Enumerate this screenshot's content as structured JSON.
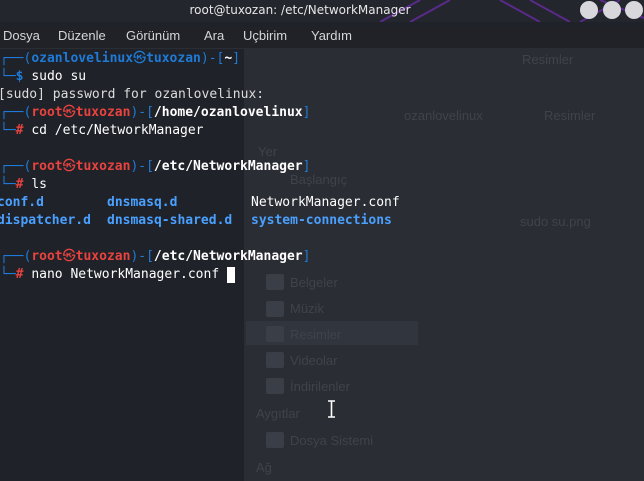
{
  "window": {
    "title": "root@tuxozan: /etc/NetworkManager"
  },
  "menu": {
    "items": [
      "Dosya",
      "Düzenle",
      "Görünüm",
      "Ara",
      "Uçbirim",
      "Yardım"
    ]
  },
  "terminal": {
    "lines": [
      {
        "user": "ozanlovelinux",
        "host": "tuxozan",
        "path": "~"
      },
      {
        "prompt": "$",
        "command": "sudo su"
      },
      {
        "output": "[sudo] password for ozanlovelinux:"
      },
      {
        "user": "root",
        "host": "tuxozan",
        "path": "/home/ozanlovelinux"
      },
      {
        "prompt": "#",
        "command": "cd /etc/NetworkManager"
      },
      {
        "user": "root",
        "host": "tuxozan",
        "path": "/etc/NetworkManager"
      },
      {
        "prompt": "#",
        "command": "ls"
      },
      {
        "user": "root",
        "host": "tuxozan",
        "path": "/etc/NetworkManager"
      },
      {
        "prompt": "#",
        "command": "nano NetworkManager.conf"
      }
    ],
    "ls_output": {
      "row1": [
        "conf.d",
        "dnsmasq.d",
        "NetworkManager.conf"
      ],
      "row2": [
        "dispatcher.d",
        "dnsmasq-shared.d",
        "system-connections"
      ]
    },
    "colors": {
      "frame": "#1f7bd8",
      "root_user": "#e8433f",
      "directory": "#4aa0ff",
      "background": "#1f2229"
    }
  },
  "background_window": {
    "texts": [
      "Resimler",
      "Yer",
      "Başlangıç",
      "Belgeler",
      "Müzik",
      "Resimler",
      "Videolar",
      "İndirilenler",
      "Aygıtlar",
      "Dosya Sistemi",
      "Ağ",
      "sudo su.png",
      "ozanlovelinux"
    ]
  }
}
